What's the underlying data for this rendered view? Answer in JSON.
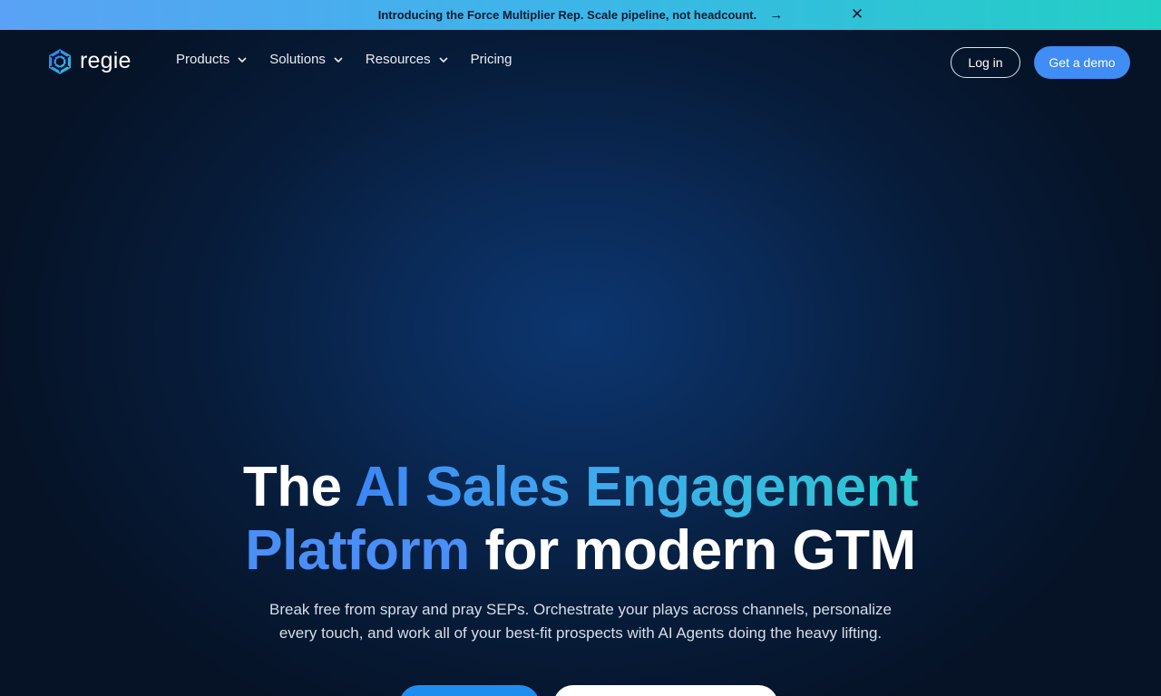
{
  "announcement": {
    "text": "Introducing the Force Multiplier Rep. Scale pipeline, not headcount.",
    "arrow_icon": "arrow-right-icon",
    "close_icon": "close-icon"
  },
  "brand": {
    "name": "regie",
    "logo_icon": "hexagon-logo-icon",
    "accent": "#3f8df5"
  },
  "nav": {
    "items": [
      {
        "label": "Products",
        "has_dropdown": true
      },
      {
        "label": "Solutions",
        "has_dropdown": true
      },
      {
        "label": "Resources",
        "has_dropdown": true
      },
      {
        "label": "Pricing",
        "has_dropdown": false
      }
    ],
    "login_label": "Log in",
    "demo_label": "Get a demo"
  },
  "hero": {
    "headline_part1": "The ",
    "headline_part2": "AI Sales Engagement",
    "headline_part3": "Platform",
    "headline_part4": " for modern GTM",
    "subheadline": "Break free from spray and pray SEPs. Orchestrate your plays across channels, personalize every touch, and work all of your best-fit prospects with AI Agents doing the heavy lifting."
  }
}
